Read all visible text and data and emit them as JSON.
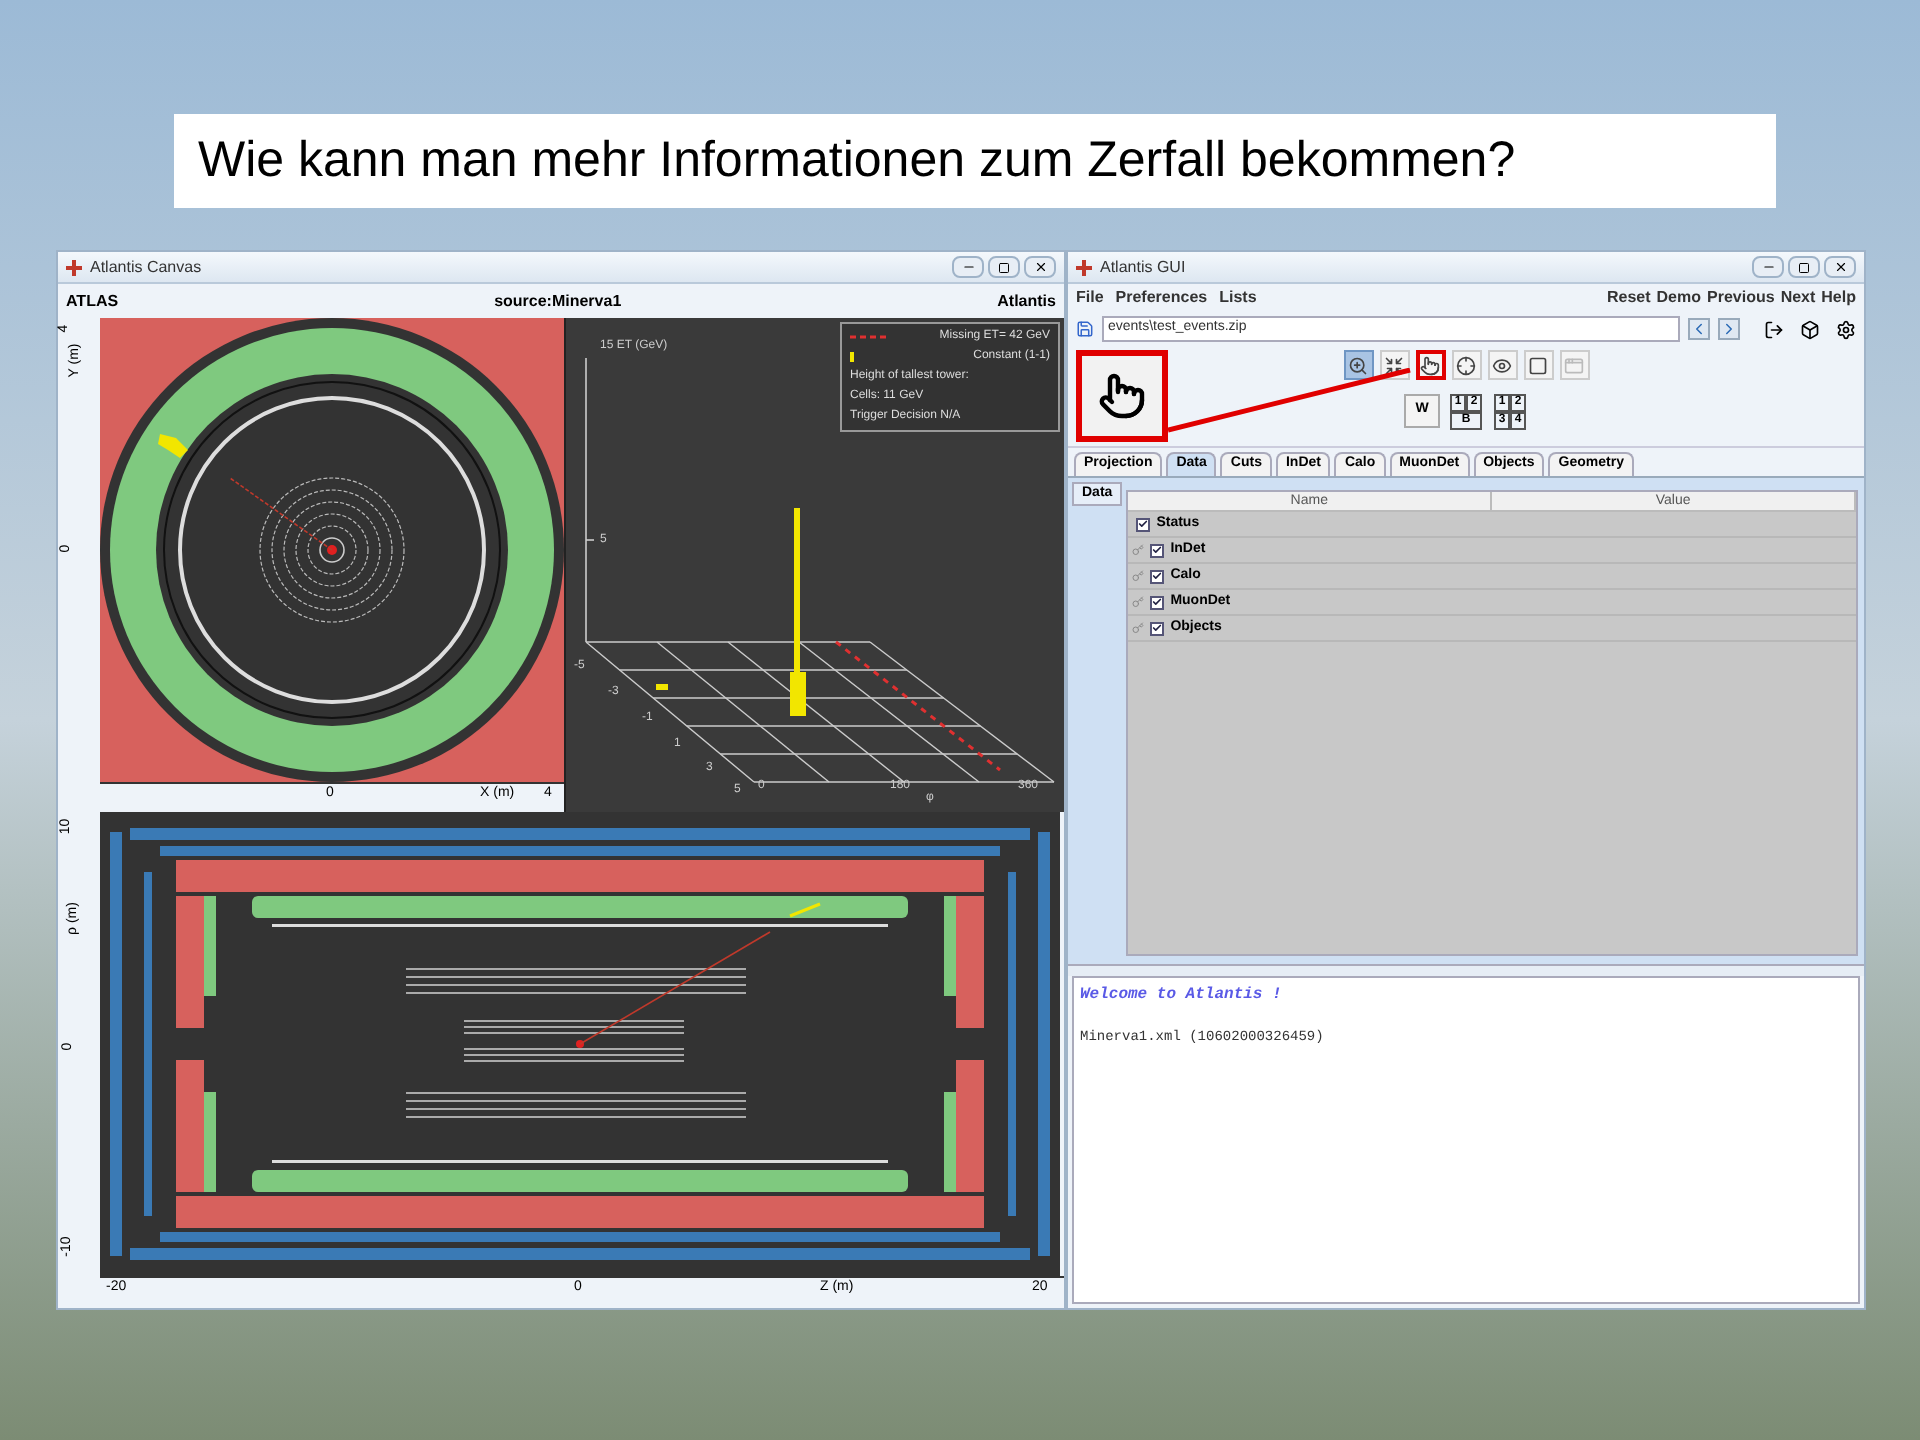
{
  "slide_title": "Wie kann man mehr Informationen zum Zerfall bekommen?",
  "canvas_window": {
    "title": "Atlantis Canvas",
    "header": {
      "left": "ATLAS",
      "center": "source:Minerva1",
      "right": "Atlantis"
    },
    "xy_view": {
      "y_label": "Y (m)",
      "y_ticks": [
        "4",
        "0"
      ],
      "x_ticks": [
        "0",
        "4"
      ],
      "x_label": "X (m)"
    },
    "lego_view": {
      "et_label": "15 ET (GeV)",
      "et_tick": "5",
      "eta_ticks": [
        "-5",
        "-3",
        "-1",
        "1",
        "3",
        "5"
      ],
      "phi_ticks": [
        "0",
        "180",
        "360"
      ],
      "phi_label": "φ",
      "legend": [
        {
          "kind": "line",
          "text": "Missing ET= 42 GeV"
        },
        {
          "kind": "marker",
          "text": "Constant (1-1)"
        },
        {
          "kind": "text",
          "text": "Height of tallest tower:"
        },
        {
          "kind": "text",
          "text": "Cells: 11 GeV"
        },
        {
          "kind": "text",
          "text": "Trigger Decision N/A"
        }
      ]
    },
    "rz_view": {
      "y_label": "ρ (m)",
      "y_ticks": [
        "10",
        "0",
        "-10"
      ],
      "x_ticks": [
        "-20",
        "0",
        "20"
      ],
      "x_label": "Z (m)"
    }
  },
  "gui_window": {
    "title": "Atlantis GUI",
    "menu": [
      "File",
      "Preferences",
      "Lists"
    ],
    "actions": [
      "Reset",
      "Demo",
      "Previous",
      "Next",
      "Help"
    ],
    "file_path": "events\\test_events.zip",
    "tools": [
      {
        "kind": "zoom",
        "selected": true,
        "disabled": false,
        "callout": false
      },
      {
        "kind": "shrink",
        "selected": false,
        "disabled": false,
        "callout": false
      },
      {
        "kind": "pick",
        "selected": false,
        "disabled": false,
        "callout": true
      },
      {
        "kind": "move",
        "selected": false,
        "disabled": false,
        "callout": false
      },
      {
        "kind": "eye",
        "selected": false,
        "disabled": false,
        "callout": false
      },
      {
        "kind": "square",
        "selected": false,
        "disabled": false,
        "callout": false
      },
      {
        "kind": "window",
        "selected": false,
        "disabled": true,
        "callout": false
      }
    ],
    "layouts": [
      {
        "cells": [
          "W"
        ]
      },
      {
        "cells": [
          "1",
          "2",
          "B"
        ]
      },
      {
        "cells": [
          "1",
          "2",
          "3",
          "4"
        ]
      }
    ],
    "tabs": [
      {
        "label": "Projection",
        "selected": false
      },
      {
        "label": "Data",
        "selected": true
      },
      {
        "label": "Cuts",
        "selected": false
      },
      {
        "label": "InDet",
        "selected": false
      },
      {
        "label": "Calo",
        "selected": false
      },
      {
        "label": "MuonDet",
        "selected": false
      },
      {
        "label": "Objects",
        "selected": false
      },
      {
        "label": "Geometry",
        "selected": false
      }
    ],
    "side_tabs": [
      {
        "label": "Data",
        "selected": true
      }
    ],
    "table": {
      "columns": [
        "Name",
        "Value"
      ],
      "rows": [
        {
          "kind": "root",
          "label": "Status",
          "checked": true
        },
        {
          "kind": "branch",
          "label": "InDet",
          "checked": true
        },
        {
          "kind": "branch",
          "label": "Calo",
          "checked": true
        },
        {
          "kind": "branch",
          "label": "MuonDet",
          "checked": true
        },
        {
          "kind": "branch",
          "label": "Objects",
          "checked": true
        }
      ]
    },
    "console": [
      {
        "kind": "welcome",
        "text": "Welcome to Atlantis !"
      },
      {
        "kind": "plain",
        "text": "Minerva1.xml (10602000326459)"
      }
    ]
  }
}
